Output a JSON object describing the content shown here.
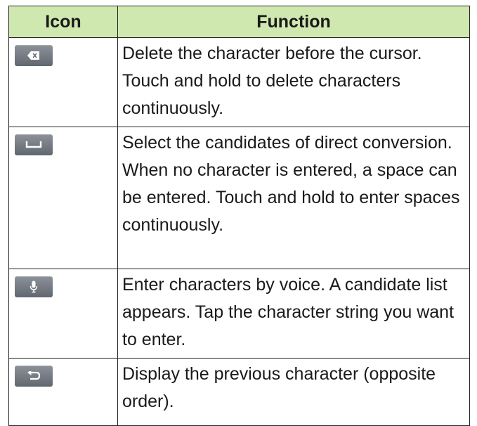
{
  "table": {
    "headers": {
      "icon": "Icon",
      "function": "Function"
    },
    "rows": [
      {
        "icon": "delete-icon",
        "description": "Delete the character before the cursor. Touch and hold to delete characters continuously."
      },
      {
        "icon": "space-icon",
        "description": "Select the candidates of direct conversion. When no character is entered, a space can be entered. Touch and hold to enter spaces continuously."
      },
      {
        "icon": "microphone-icon",
        "description": "Enter characters by voice. A candidate list appears. Tap the character string you want to enter."
      },
      {
        "icon": "undo-icon",
        "description": "Display the previous character (opposite order)."
      }
    ]
  },
  "colors": {
    "header_bg": "#cfe8b0",
    "key_bg": "#6f747c",
    "border": "#222222"
  }
}
